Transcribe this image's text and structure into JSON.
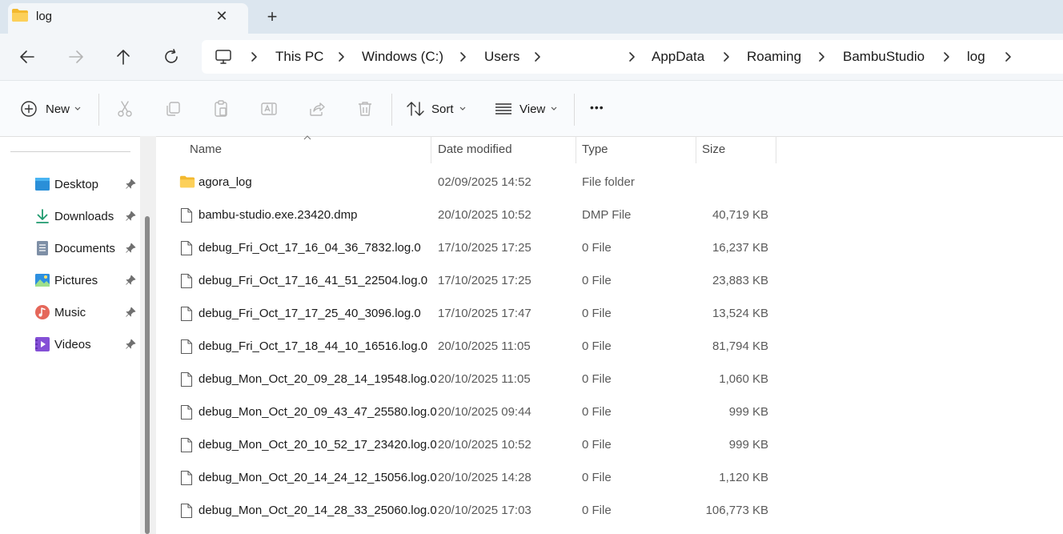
{
  "tab": {
    "title": "log",
    "close_glyph": "✕",
    "new_tab_glyph": "+"
  },
  "breadcrumb": [
    "This PC",
    "Windows (C:)",
    "Users",
    "AppData",
    "Roaming",
    "BambuStudio",
    "log"
  ],
  "toolbar": {
    "new_label": "New",
    "sort_label": "Sort",
    "view_label": "View",
    "more_glyph": "•••"
  },
  "sidebar": {
    "items": [
      {
        "label": "Desktop",
        "icon": "desktop-icon"
      },
      {
        "label": "Downloads",
        "icon": "downloads-icon"
      },
      {
        "label": "Documents",
        "icon": "documents-icon"
      },
      {
        "label": "Pictures",
        "icon": "pictures-icon"
      },
      {
        "label": "Music",
        "icon": "music-icon"
      },
      {
        "label": "Videos",
        "icon": "videos-icon"
      }
    ]
  },
  "columns": {
    "name": "Name",
    "date": "Date modified",
    "type": "Type",
    "size": "Size"
  },
  "files": [
    {
      "name": "agora_log",
      "date": "02/09/2025 14:52",
      "type": "File folder",
      "size": "",
      "kind": "folder"
    },
    {
      "name": "bambu-studio.exe.23420.dmp",
      "date": "20/10/2025 10:52",
      "type": "DMP File",
      "size": "40,719 KB",
      "kind": "file"
    },
    {
      "name": "debug_Fri_Oct_17_16_04_36_7832.log.0",
      "date": "17/10/2025 17:25",
      "type": "0 File",
      "size": "16,237 KB",
      "kind": "file"
    },
    {
      "name": "debug_Fri_Oct_17_16_41_51_22504.log.0",
      "date": "17/10/2025 17:25",
      "type": "0 File",
      "size": "23,883 KB",
      "kind": "file"
    },
    {
      "name": "debug_Fri_Oct_17_17_25_40_3096.log.0",
      "date": "17/10/2025 17:47",
      "type": "0 File",
      "size": "13,524 KB",
      "kind": "file"
    },
    {
      "name": "debug_Fri_Oct_17_18_44_10_16516.log.0",
      "date": "20/10/2025 11:05",
      "type": "0 File",
      "size": "81,794 KB",
      "kind": "file"
    },
    {
      "name": "debug_Mon_Oct_20_09_28_14_19548.log.0",
      "date": "20/10/2025 11:05",
      "type": "0 File",
      "size": "1,060 KB",
      "kind": "file"
    },
    {
      "name": "debug_Mon_Oct_20_09_43_47_25580.log.0",
      "date": "20/10/2025 09:44",
      "type": "0 File",
      "size": "999 KB",
      "kind": "file"
    },
    {
      "name": "debug_Mon_Oct_20_10_52_17_23420.log.0",
      "date": "20/10/2025 10:52",
      "type": "0 File",
      "size": "999 KB",
      "kind": "file"
    },
    {
      "name": "debug_Mon_Oct_20_14_24_12_15056.log.0",
      "date": "20/10/2025 14:28",
      "type": "0 File",
      "size": "1,120 KB",
      "kind": "file"
    },
    {
      "name": "debug_Mon_Oct_20_14_28_33_25060.log.0",
      "date": "20/10/2025 17:03",
      "type": "0 File",
      "size": "106,773 KB",
      "kind": "file"
    }
  ]
}
